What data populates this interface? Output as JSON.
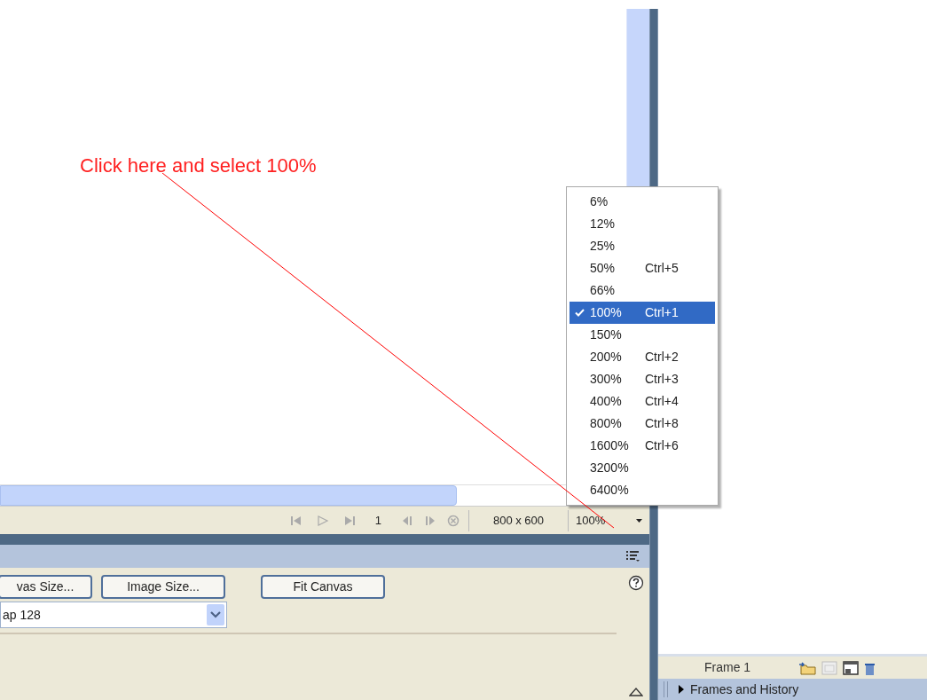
{
  "annotation": {
    "text": "Click here and select 100%"
  },
  "zoom_menu": {
    "items": [
      {
        "label": "6%",
        "selected": false
      },
      {
        "label": "12%",
        "selected": false
      },
      {
        "label": "25%",
        "selected": false
      },
      {
        "label": "50%",
        "shortcut": "Ctrl+5",
        "selected": false
      },
      {
        "label": "66%",
        "selected": false
      },
      {
        "label": "100%",
        "shortcut": "Ctrl+1",
        "selected": true
      },
      {
        "label": "150%",
        "selected": false
      },
      {
        "label": "200%",
        "shortcut": "Ctrl+2",
        "selected": false
      },
      {
        "label": "300%",
        "shortcut": "Ctrl+3",
        "selected": false
      },
      {
        "label": "400%",
        "shortcut": "Ctrl+4",
        "selected": false
      },
      {
        "label": "800%",
        "shortcut": "Ctrl+8",
        "selected": false
      },
      {
        "label": "1600%",
        "shortcut": "Ctrl+6",
        "selected": false
      },
      {
        "label": "3200%",
        "selected": false
      },
      {
        "label": "6400%",
        "selected": false
      }
    ]
  },
  "status_bar": {
    "frame": "1",
    "size": "800 x 600",
    "zoom": "100%"
  },
  "properties_panel": {
    "buttons": [
      "vas Size...",
      "Image Size...",
      "Fit Canvas"
    ],
    "dropdown": {
      "value": "ap 128"
    }
  },
  "frame_row": {
    "label": "Frame 1"
  },
  "frames_panel": {
    "title": "Frames and History",
    "expanded": false
  }
}
